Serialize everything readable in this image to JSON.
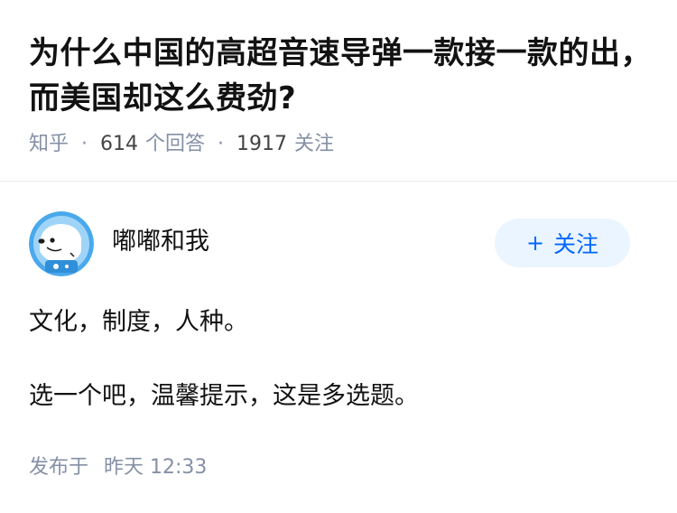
{
  "question": {
    "title": "为什么中国的高超音速导弹一款接一款的出，而美国却这么费劲?",
    "source": "知乎",
    "answer_count": "614",
    "answer_label": "个回答",
    "follower_count": "1917",
    "follower_label": "关注"
  },
  "answer": {
    "author_name": "嘟嘟和我",
    "follow_button": "关注",
    "paragraphs": [
      "文化，制度，人种。",
      "选一个吧，温馨提示，这是多选题。"
    ],
    "published_label": "发布于",
    "published_time": "昨天 12:33"
  },
  "colors": {
    "title_text": "#121212",
    "meta_text": "#8590a6",
    "accent": "#0066ff",
    "follow_bg": "#ebf5ff",
    "avatar_blue": "#4aa8ec"
  }
}
